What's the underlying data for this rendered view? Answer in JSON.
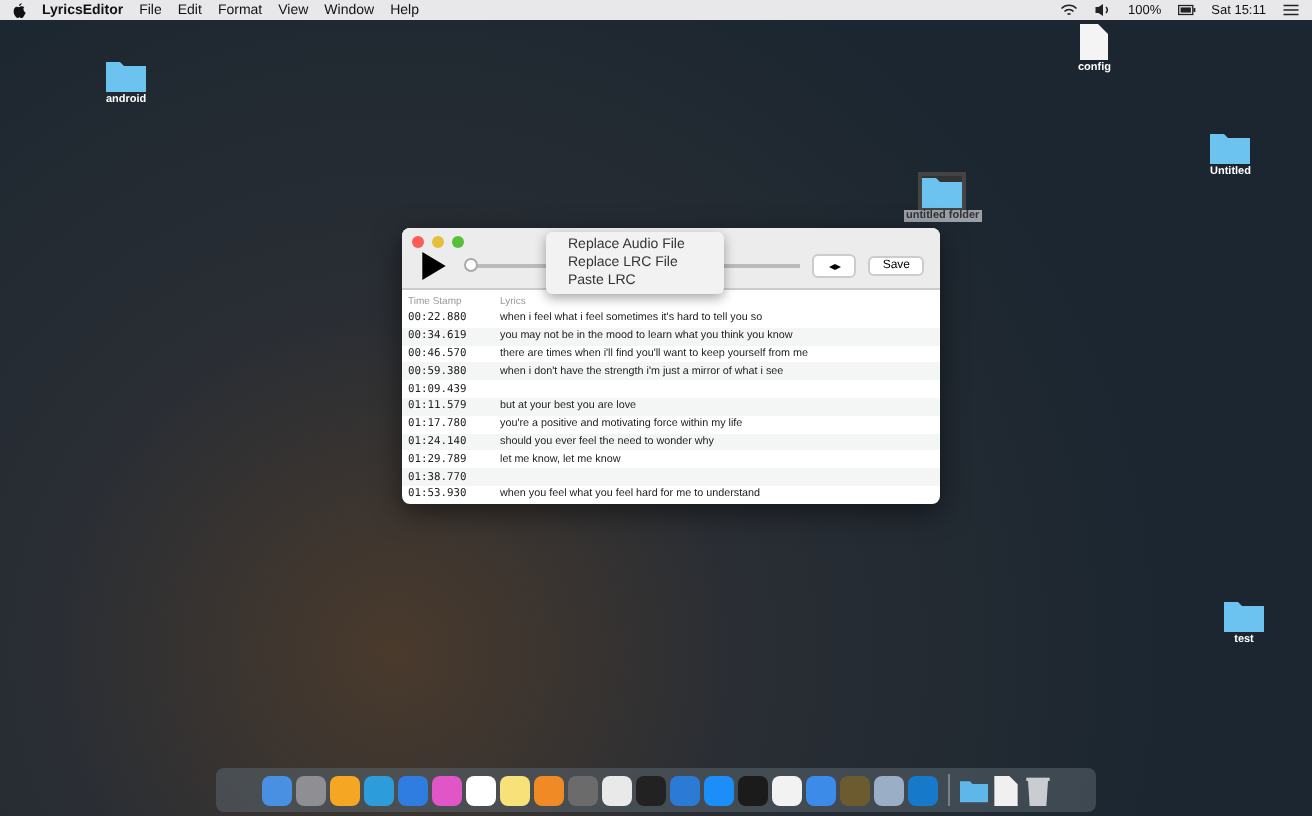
{
  "menu_bar": {
    "app_name": "LyricsEditor",
    "menus": [
      "File",
      "Edit",
      "Format",
      "View",
      "Window",
      "Help"
    ],
    "battery_text": "100%",
    "clock": "Sat 15:11"
  },
  "desktop_icons": [
    {
      "kind": "folder",
      "label": "android",
      "selected": false
    },
    {
      "kind": "file",
      "label": "config",
      "selected": false
    },
    {
      "kind": "folder",
      "label": "Untitled",
      "selected": false
    },
    {
      "kind": "folder",
      "label": "untitled folder",
      "selected": true
    },
    {
      "kind": "folder",
      "label": "test",
      "selected": false
    }
  ],
  "window": {
    "slider": {
      "level": 0
    },
    "popup_menu": [
      "Replace Audio File",
      "Replace LRC File",
      "Paste LRC"
    ],
    "buttons": [
      "◂▸",
      "Save"
    ],
    "table": {
      "columns": [
        "Time Stamp",
        "Lyrics"
      ],
      "rows": [
        [
          "00:22.880",
          "when i feel what i feel sometimes it's hard to tell you so"
        ],
        [
          "00:34.619",
          "you may not be in the mood to learn what you think you know"
        ],
        [
          "00:46.570",
          "there are times when i'll find you'll want to keep yourself from me"
        ],
        [
          "00:59.380",
          "when i don't have the strength i'm just a mirror of what i see"
        ],
        [
          "01:09.439",
          ""
        ],
        [
          "01:11.579",
          "but at your best you are love"
        ],
        [
          "01:17.780",
          "you're a positive and motivating force within my life"
        ],
        [
          "01:24.140",
          "should you ever feel the need to wonder why"
        ],
        [
          "01:29.789",
          "let me know, let me know"
        ],
        [
          "01:38.770",
          ""
        ],
        [
          "01:53.930",
          "when you feel what you feel hard for me to understand"
        ]
      ]
    }
  }
}
